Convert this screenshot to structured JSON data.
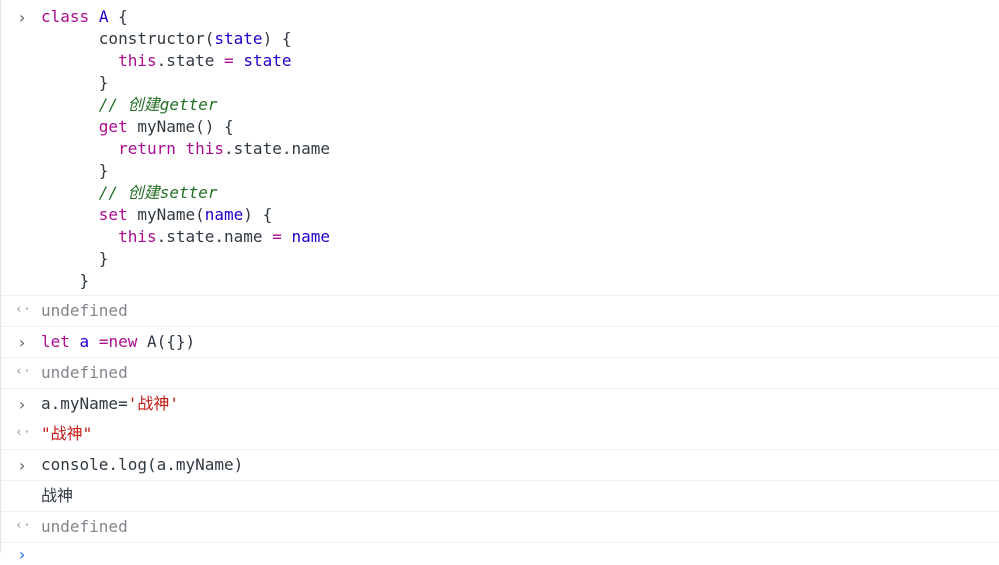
{
  "console": {
    "class_block": [
      {
        "indent": "",
        "parts": [
          [
            "kw",
            "class"
          ],
          [
            "id",
            " "
          ],
          [
            "var",
            "A"
          ],
          [
            "id",
            " {"
          ]
        ]
      },
      {
        "indent": "      ",
        "parts": [
          [
            "id",
            "constructor("
          ],
          [
            "var",
            "state"
          ],
          [
            "id",
            ") {"
          ]
        ]
      },
      {
        "indent": "        ",
        "parts": [
          [
            "kw",
            "this"
          ],
          [
            "id",
            ".state "
          ],
          [
            "kw",
            "="
          ],
          [
            "id",
            " "
          ],
          [
            "var",
            "state"
          ]
        ]
      },
      {
        "indent": "      ",
        "parts": [
          [
            "id",
            "}"
          ]
        ]
      },
      {
        "indent": "      ",
        "parts": [
          [
            "cm",
            "// 创建getter"
          ]
        ]
      },
      {
        "indent": "      ",
        "parts": [
          [
            "kw",
            "get"
          ],
          [
            "id",
            " myName() {"
          ]
        ]
      },
      {
        "indent": "        ",
        "parts": [
          [
            "kw",
            "return"
          ],
          [
            "id",
            " "
          ],
          [
            "kw",
            "this"
          ],
          [
            "id",
            ".state.name"
          ]
        ]
      },
      {
        "indent": "      ",
        "parts": [
          [
            "id",
            "}"
          ]
        ]
      },
      {
        "indent": "      ",
        "parts": [
          [
            "cm",
            "// 创建setter"
          ]
        ]
      },
      {
        "indent": "      ",
        "parts": [
          [
            "kw",
            "set"
          ],
          [
            "id",
            " myName("
          ],
          [
            "var",
            "name"
          ],
          [
            "id",
            ") {"
          ]
        ]
      },
      {
        "indent": "        ",
        "parts": [
          [
            "kw",
            "this"
          ],
          [
            "id",
            ".state.name "
          ],
          [
            "kw",
            "="
          ],
          [
            "id",
            " "
          ],
          [
            "var",
            "name"
          ]
        ]
      },
      {
        "indent": "      ",
        "parts": [
          [
            "id",
            "}"
          ]
        ]
      },
      {
        "indent": "    ",
        "parts": [
          [
            "id",
            "}"
          ]
        ]
      }
    ],
    "result_1": "undefined",
    "cmd_2": {
      "kw": "let",
      "var": "a",
      "op": " =",
      "kw2": "new",
      "rest": " A({})"
    },
    "result_2": "undefined",
    "cmd_3": {
      "prefix": "a.myName=",
      "str": "'战神'"
    },
    "result_3": "\"战神\"",
    "cmd_4": "console.log(a.myName)",
    "log_4": "战神",
    "result_4": "undefined"
  },
  "icons": {
    "input_chevron": "›",
    "output_arrow": "‹·",
    "prompt_chevron": "›"
  }
}
